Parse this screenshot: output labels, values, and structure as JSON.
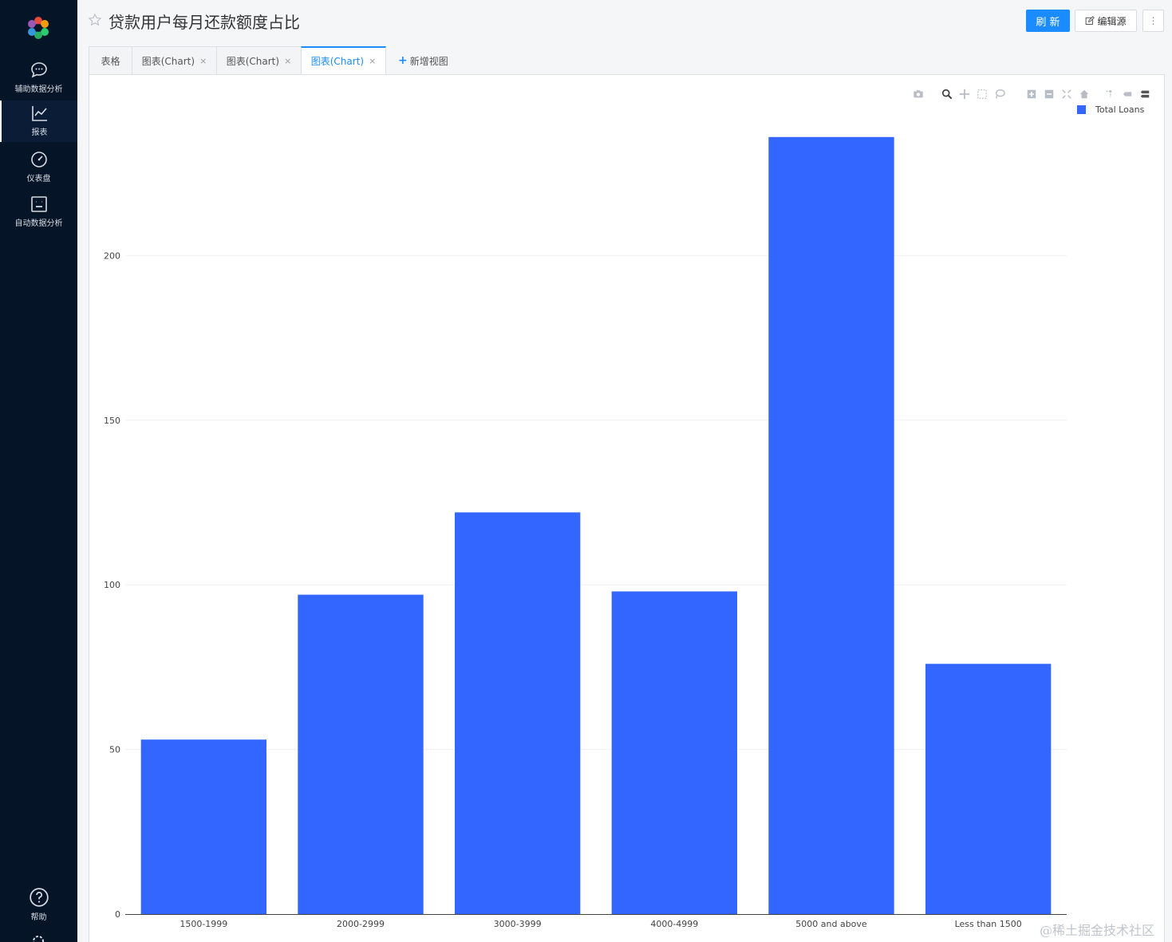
{
  "app": {
    "title": "贷款用户每月还款额度占比",
    "buttons": {
      "refresh": "刷 新",
      "edit_source": "编辑源",
      "more": "⋮"
    }
  },
  "sidebar": {
    "items": [
      {
        "label": "辅助数据分析",
        "icon": "chat-icon"
      },
      {
        "label": "报表",
        "icon": "line-chart-icon"
      },
      {
        "label": "仪表盘",
        "icon": "gauge-icon"
      },
      {
        "label": "自动数据分析",
        "icon": "robot-icon"
      }
    ],
    "bottom": {
      "label": "帮助",
      "icon": "help-icon"
    }
  },
  "tabs": [
    {
      "label": "表格",
      "closable": false,
      "active": false
    },
    {
      "label": "图表(Chart)",
      "closable": true,
      "active": false
    },
    {
      "label": "图表(Chart)",
      "closable": true,
      "active": false
    },
    {
      "label": "图表(Chart)",
      "closable": true,
      "active": true
    }
  ],
  "add_view": "新增视图",
  "chart_data": {
    "type": "bar",
    "categories": [
      "1500-1999",
      "2000-2999",
      "3000-3999",
      "4000-4999",
      "5000 and above",
      "Less than 1500"
    ],
    "series": [
      {
        "name": "Total Loans",
        "values": [
          53,
          97,
          122,
          98,
          236,
          76
        ]
      }
    ],
    "ylim": [
      0,
      250
    ],
    "yticks": [
      0,
      50,
      100,
      150,
      200
    ],
    "legend": "top-right",
    "grid": true,
    "colors": {
      "bar": "#3366ff"
    }
  },
  "watermark": "@稀土掘金技术社区"
}
